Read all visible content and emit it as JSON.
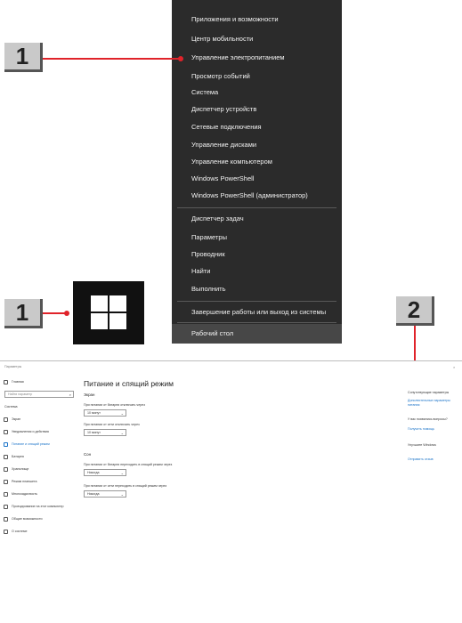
{
  "menu": {
    "items": [
      "Приложения и возможности",
      "Центр мобильности",
      "Управление электропитанием",
      "Просмотр событий",
      "Система",
      "Диспетчер устройств",
      "Сетевые подключения",
      "Управление дисками",
      "Управление компьютером",
      "Windows PowerShell",
      "Windows PowerShell (администратор)",
      "Диспетчер задач",
      "Параметры",
      "Проводник",
      "Найти",
      "Выполнить",
      "Завершение работы или выход из системы",
      "Рабочий стол"
    ]
  },
  "callouts": {
    "step1": "1",
    "step2": "2"
  },
  "settings": {
    "window_title": "Параметры",
    "home": "Главная",
    "search_placeholder": "Найти параметр",
    "section": "Система",
    "sidebar": [
      "Экран",
      "Уведомления и действия",
      "Питание и спящий режим",
      "Батарея",
      "Хранилище",
      "Режим планшета",
      "Многозадачность",
      "Проецирование на этот компьютер",
      "Общие возможности",
      "О системе"
    ],
    "page_title": "Питание и спящий режим",
    "screen_heading": "Экран",
    "screen_battery_label": "При питании от батареи отключать через",
    "screen_battery_value": "10 минут",
    "screen_plugged_label": "При питании от сети отключать через",
    "screen_plugged_value": "10 минут",
    "sleep_heading": "Сон",
    "sleep_battery_label": "При питании от батареи переходить в спящий режим через",
    "sleep_battery_value": "Никогда",
    "sleep_plugged_label": "При питании от сети переходить в спящий режим через",
    "sleep_plugged_value": "Никогда",
    "related_heading": "Сопутствующие параметры",
    "related_link": "Дополнительные параметры питания",
    "question_heading": "У вас появились вопросы?",
    "help_link": "Получить помощь",
    "improve_heading": "Улучшите Windows",
    "feedback_link": "Отправить отзыв"
  }
}
